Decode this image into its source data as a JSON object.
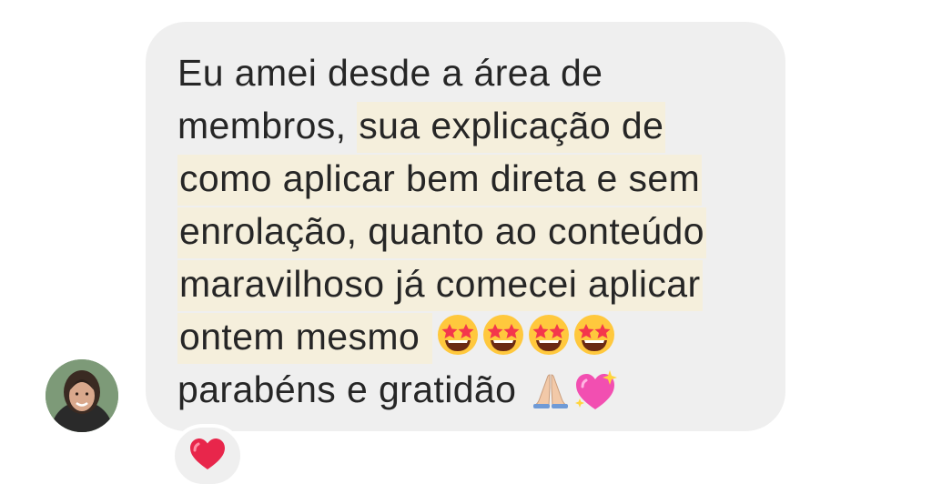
{
  "message": {
    "lines": [
      {
        "plain": "Eu amei desde a área de",
        "highlight": ""
      },
      {
        "plain": "membros, ",
        "highlight": "sua explicação de"
      },
      {
        "plain": "",
        "highlight": "como aplicar bem direta e sem"
      },
      {
        "plain": "",
        "highlight": "enrolação, quanto ao conteúdo"
      },
      {
        "plain": "",
        "highlight": "maravilhoso já comecei aplicar"
      },
      {
        "plain": "",
        "highlight": "ontem mesmo "
      },
      {
        "plain": "parabéns e gratidão ",
        "highlight": ""
      }
    ],
    "emojis_line6": [
      "star-struck-emoji",
      "star-struck-emoji",
      "star-struck-emoji",
      "star-struck-emoji"
    ],
    "emojis_line7": [
      "folded-hands-emoji",
      "sparkling-heart-emoji"
    ]
  },
  "reaction": {
    "icon": "red-heart-emoji"
  },
  "colors": {
    "bubble": "#efefef",
    "text": "#262626",
    "highlight": "#f5efdc",
    "heart": "#e8264b"
  }
}
